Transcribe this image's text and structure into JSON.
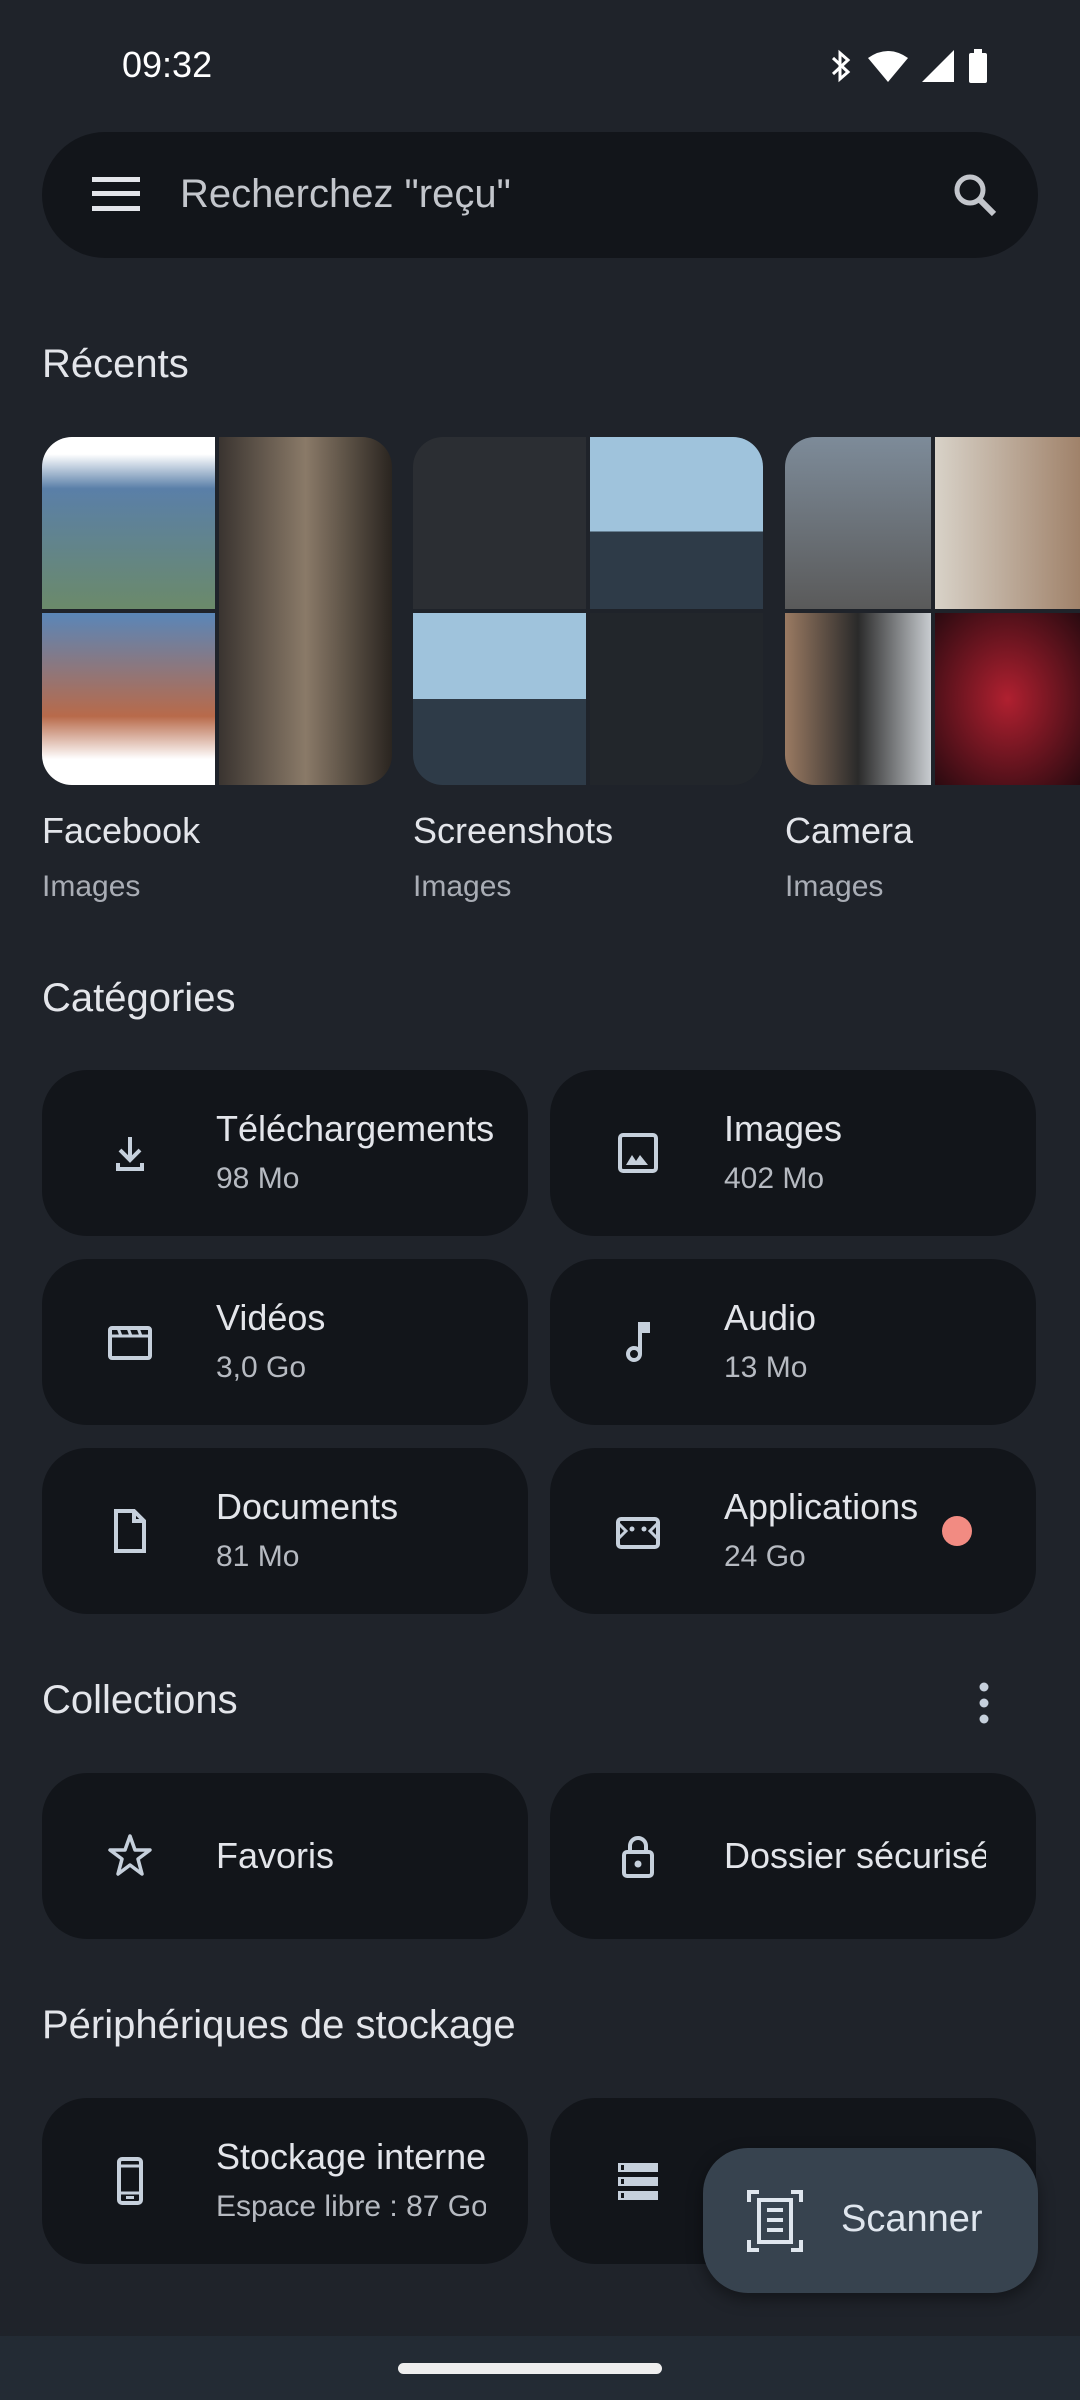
{
  "status_bar": {
    "time": "09:32",
    "icons": [
      "bluetooth-icon",
      "wifi-icon",
      "signal-icon",
      "battery-icon"
    ]
  },
  "search": {
    "placeholder": "Recherchez \"reçu\"",
    "menu_icon": "menu-icon",
    "search_icon": "search-icon"
  },
  "recents": {
    "heading": "Récents",
    "items": [
      {
        "title": "Facebook",
        "subtitle": "Images",
        "colors": [
          "#5a7fa8",
          "#8aa2b8",
          "#4f7a96",
          "#6b5a48"
        ]
      },
      {
        "title": "Screenshots",
        "subtitle": "Images",
        "colors": [
          "#2b2e33",
          "#8fb3cc",
          "#7fa3be",
          "#22262b"
        ]
      },
      {
        "title": "Camera",
        "subtitle": "Images",
        "colors": [
          "#7d8b99",
          "#a0826a",
          "#b9bcc0",
          "#5a1a22"
        ]
      }
    ]
  },
  "categories": {
    "heading": "Catégories",
    "items": [
      {
        "title": "Téléchargements",
        "size": "98 Mo",
        "icon": "download-icon"
      },
      {
        "title": "Images",
        "size": "402 Mo",
        "icon": "image-icon"
      },
      {
        "title": "Vidéos",
        "size": "3,0 Go",
        "icon": "video-icon"
      },
      {
        "title": "Audio",
        "size": "13 Mo",
        "icon": "music-note-icon"
      },
      {
        "title": "Documents",
        "size": "81 Mo",
        "icon": "document-icon"
      },
      {
        "title": "Applications",
        "size": "24 Go",
        "icon": "android-icon",
        "badge_color": "#f28b82"
      }
    ]
  },
  "collections": {
    "heading": "Collections",
    "more_icon": "more-vert-icon",
    "items": [
      {
        "title": "Favoris",
        "icon": "star-icon"
      },
      {
        "title": "Dossier sécurisé",
        "icon": "lock-icon"
      }
    ]
  },
  "storage": {
    "heading": "Périphériques de stockage",
    "items": [
      {
        "title": "Stockage interne",
        "subtitle": "Espace libre : 87 Go",
        "icon": "phone-icon"
      },
      {
        "title": "",
        "icon": "storage-icon"
      }
    ]
  },
  "fab": {
    "label": "Scanner",
    "icon": "document-scanner-icon",
    "color": "#37434f"
  },
  "colors": {
    "background": "#1f232a",
    "card": "#12151a",
    "accent": "#f28b82"
  }
}
